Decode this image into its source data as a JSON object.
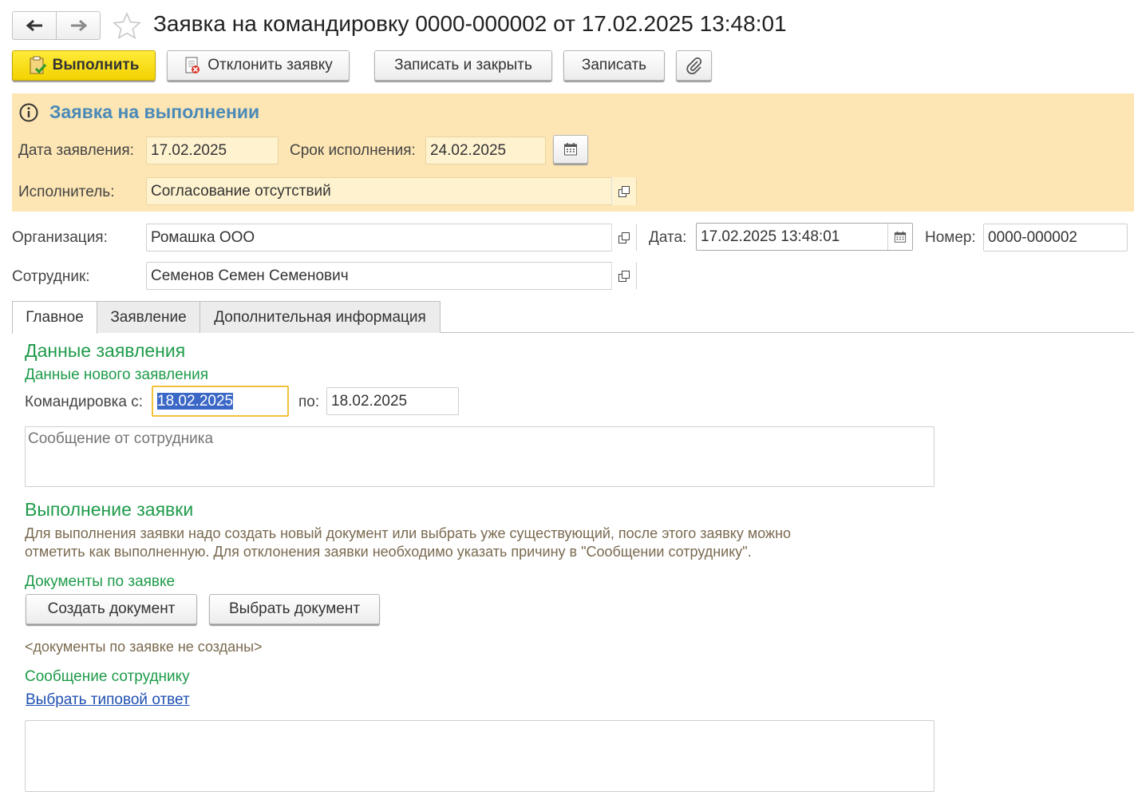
{
  "window": {
    "title": "Заявка на командировку 0000-000002 от 17.02.2025 13:48:01"
  },
  "toolbar": {
    "execute_label": "Выполнить",
    "reject_label": "Отклонить заявку",
    "save_close_label": "Записать и закрыть",
    "save_label": "Записать"
  },
  "status_panel": {
    "title": "Заявка на выполнении",
    "date_label": "Дата заявления:",
    "date_value": "17.02.2025",
    "deadline_label": "Срок исполнения:",
    "deadline_value": "24.02.2025",
    "executor_label": "Исполнитель:",
    "executor_value": "Согласование отсутствий"
  },
  "header": {
    "org_label": "Организация:",
    "org_value": "Ромашка ООО",
    "date_label": "Дата:",
    "date_value": "17.02.2025 13:48:01",
    "number_label": "Номер:",
    "number_value": "0000-000002",
    "employee_label": "Сотрудник:",
    "employee_value": "Семенов Семен Семенович"
  },
  "tabs": [
    {
      "label": "Главное",
      "active": true
    },
    {
      "label": "Заявление",
      "active": false
    },
    {
      "label": "Дополнительная информация",
      "active": false
    }
  ],
  "main": {
    "request_data_title": "Данные заявления",
    "new_request_subtitle": "Данные нового заявления",
    "trip_from_label": "Командировка с:",
    "trip_from_value": "18.02.2025",
    "trip_to_label": "по:",
    "trip_to_value": "18.02.2025",
    "employee_message_placeholder": "Сообщение от сотрудника",
    "execution_title": "Выполнение заявки",
    "execution_text_line1": "Для выполнения заявки надо создать новый документ или выбрать уже существующий, после этого заявку можно",
    "execution_text_line2": "отметить как выполненную. Для отклонения заявки необходимо указать причину в \"Сообщении сотруднику\".",
    "documents_title": "Документы по заявке",
    "create_doc_label": "Создать документ",
    "select_doc_label": "Выбрать документ",
    "no_documents_text": "<документы по заявке не созданы>",
    "message_to_employee_title": "Сообщение сотруднику",
    "select_template_link": "Выбрать типовой ответ"
  },
  "colors": {
    "accent_yellow": "#f5d60c",
    "status_panel_bg": "#fde6b4",
    "section_green": "#1e9b4a",
    "status_title_blue": "#4a8ab8",
    "link_blue": "#1f4fb0",
    "hint_olive": "#7a6a4f"
  }
}
